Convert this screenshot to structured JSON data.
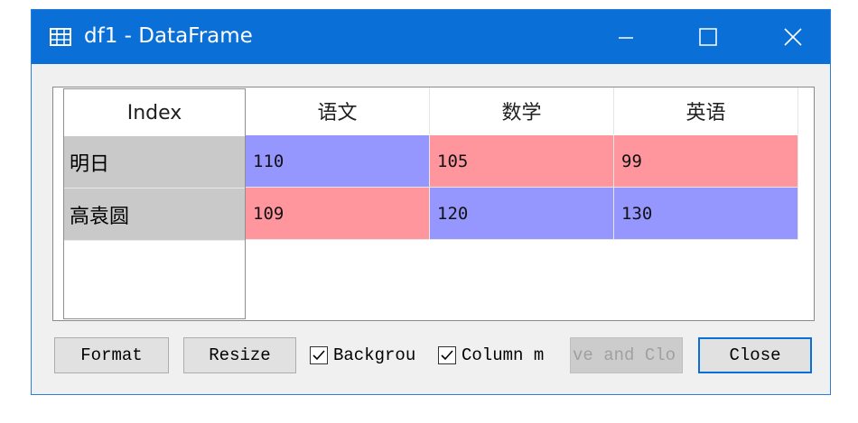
{
  "window": {
    "title": "df1 - DataFrame",
    "title_icon": "table-icon",
    "controls": [
      "minimize-icon",
      "maximize-icon",
      "close-icon"
    ],
    "titlebar_color": "#0a6fd6"
  },
  "table": {
    "index_header": "Index",
    "columns": [
      "语文",
      "数学",
      "英语"
    ],
    "rows": [
      {
        "index": "明日",
        "values": [
          "110",
          "105",
          "99"
        ],
        "colors": [
          "#9696ff",
          "#ff969d",
          "#ff969d"
        ]
      },
      {
        "index": "高袁圆",
        "values": [
          "109",
          "120",
          "130"
        ],
        "colors": [
          "#ff969d",
          "#9696ff",
          "#9696ff"
        ]
      }
    ],
    "index_bg": "#c9c9c9"
  },
  "footer": {
    "format_label": "Format",
    "resize_label": "Resize",
    "background_label": "Backgrou",
    "background_checked": true,
    "column_label": "Column m",
    "column_checked": true,
    "save_close_label": "ve and Clo",
    "close_label": "Close"
  }
}
